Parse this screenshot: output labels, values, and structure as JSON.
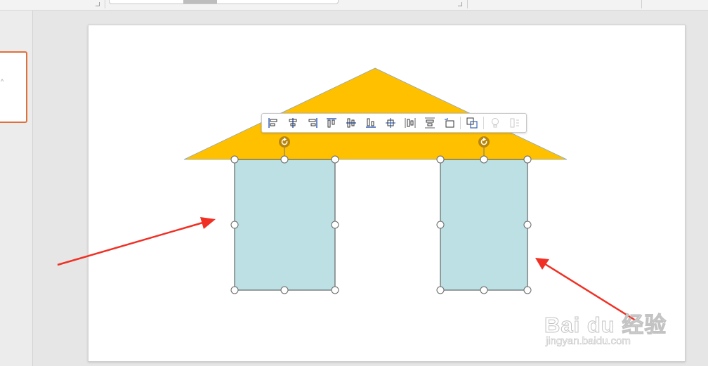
{
  "watermark": {
    "brand_text": "Bai du 经验",
    "url_text": "jingyan.baidu.com"
  },
  "toolbar": {
    "buttons": [
      {
        "icon": "align-left-icon"
      },
      {
        "icon": "align-center-icon"
      },
      {
        "icon": "align-right-icon"
      },
      {
        "icon": "align-top-icon"
      },
      {
        "icon": "align-middle-icon"
      },
      {
        "icon": "align-bottom-icon"
      },
      {
        "icon": "align-center-both-icon"
      },
      {
        "icon": "distribute-horizontal-icon"
      },
      {
        "icon": "distribute-vertical-icon"
      },
      {
        "icon": "align-to-slide-icon"
      },
      {
        "icon": "group-icon"
      },
      {
        "icon": "lightbulb-icon",
        "enabled": false
      },
      {
        "icon": "more-options-icon",
        "enabled": false
      }
    ]
  },
  "shapes": {
    "roof": {
      "fill": "#FFC000"
    },
    "pillars": {
      "fill": "#BCE0E4"
    },
    "rotate_handle_color": "#B8860B",
    "arrow_color": "#F03024"
  },
  "colors": {
    "thumbnail_border": "#E0703A",
    "toolbar_icon": "#3B63B8"
  }
}
